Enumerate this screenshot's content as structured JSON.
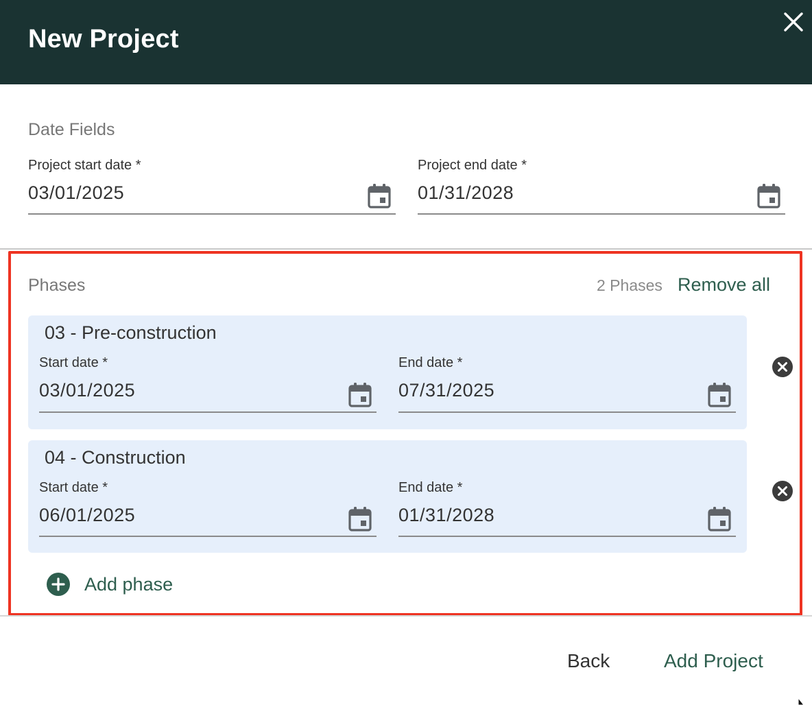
{
  "dialog": {
    "title": "New Project"
  },
  "date_fields": {
    "section_label": "Date Fields",
    "start": {
      "label": "Project start date *",
      "value": "03/01/2025"
    },
    "end": {
      "label": "Project end date *",
      "value": "01/31/2028"
    }
  },
  "phases": {
    "section_label": "Phases",
    "count_label": "2 Phases",
    "remove_all_label": "Remove all",
    "items": [
      {
        "title": "03 - Pre-construction",
        "start_label": "Start date *",
        "start_value": "03/01/2025",
        "end_label": "End date *",
        "end_value": "07/31/2025"
      },
      {
        "title": "04 - Construction",
        "start_label": "Start date *",
        "start_value": "06/01/2025",
        "end_label": "End date *",
        "end_value": "01/31/2028"
      }
    ],
    "add_phase_label": "Add phase"
  },
  "footer": {
    "back_label": "Back",
    "add_project_label": "Add Project"
  },
  "colors": {
    "header_bg": "#1a3332",
    "accent": "#2e5e4e",
    "phase_card_bg": "#e6effb",
    "highlight": "#ee3322"
  },
  "icons": {
    "close": "close-icon",
    "calendar": "calendar-icon",
    "remove_phase": "cancel-circle-icon",
    "add_phase": "plus-circle-icon"
  }
}
